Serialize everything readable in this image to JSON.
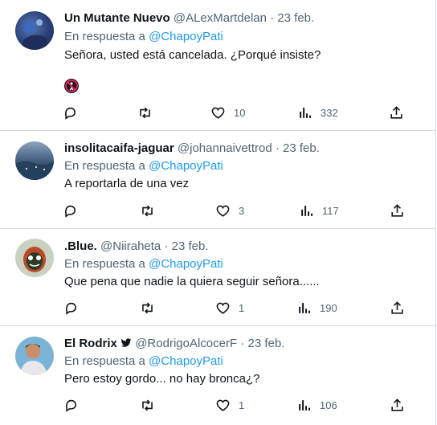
{
  "replying_label": "En respuesta a",
  "tweets": [
    {
      "name": "Un Mutante Nuevo",
      "handle": "@ALexMartdelan",
      "date": "· 23 feb.",
      "reply_to": "@ChapoyPati",
      "text": "Señora, usted está cancelada. ¿Porqué insiste?",
      "likes": "10",
      "views": "332",
      "emoji": "⛔"
    },
    {
      "name": "insolitacaifa-jaguar",
      "handle": "@johannaivettrod",
      "date": "· 23 feb.",
      "reply_to": "@ChapoyPati",
      "text": "A reportarla de una vez",
      "likes": "3",
      "views": "117"
    },
    {
      "name": ".Blue.",
      "handle": "@Niiraheta",
      "date": "· 23 feb.",
      "reply_to": "@ChapoyPati",
      "text": "Que pena que nadie la quiera seguir señora......",
      "likes": "1",
      "views": "190"
    },
    {
      "name": "El Rodrix",
      "handle": "@RodrigoAlcocerF",
      "date": "· 23 feb.",
      "reply_to": "@ChapoyPati",
      "text": "Pero estoy gordo... no hay bronca¿?",
      "likes": "1",
      "views": "106"
    }
  ],
  "icons": {
    "reply": "reply-icon",
    "retweet": "retweet-icon",
    "like": "heart-icon",
    "views": "views-icon",
    "share": "share-icon"
  }
}
